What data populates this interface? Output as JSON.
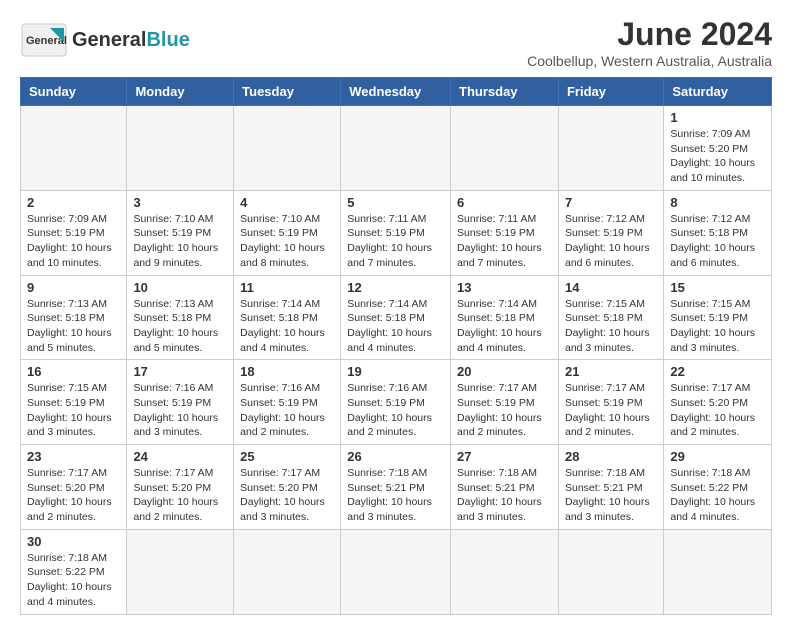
{
  "header": {
    "logo_general": "General",
    "logo_blue": "Blue",
    "month_title": "June 2024",
    "subtitle": "Coolbellup, Western Australia, Australia"
  },
  "weekdays": [
    "Sunday",
    "Monday",
    "Tuesday",
    "Wednesday",
    "Thursday",
    "Friday",
    "Saturday"
  ],
  "weeks": [
    [
      {
        "day": "",
        "info": ""
      },
      {
        "day": "",
        "info": ""
      },
      {
        "day": "",
        "info": ""
      },
      {
        "day": "",
        "info": ""
      },
      {
        "day": "",
        "info": ""
      },
      {
        "day": "",
        "info": ""
      },
      {
        "day": "1",
        "info": "Sunrise: 7:09 AM\nSunset: 5:20 PM\nDaylight: 10 hours\nand 10 minutes."
      }
    ],
    [
      {
        "day": "2",
        "info": "Sunrise: 7:09 AM\nSunset: 5:19 PM\nDaylight: 10 hours\nand 10 minutes."
      },
      {
        "day": "3",
        "info": "Sunrise: 7:10 AM\nSunset: 5:19 PM\nDaylight: 10 hours\nand 9 minutes."
      },
      {
        "day": "4",
        "info": "Sunrise: 7:10 AM\nSunset: 5:19 PM\nDaylight: 10 hours\nand 8 minutes."
      },
      {
        "day": "5",
        "info": "Sunrise: 7:11 AM\nSunset: 5:19 PM\nDaylight: 10 hours\nand 7 minutes."
      },
      {
        "day": "6",
        "info": "Sunrise: 7:11 AM\nSunset: 5:19 PM\nDaylight: 10 hours\nand 7 minutes."
      },
      {
        "day": "7",
        "info": "Sunrise: 7:12 AM\nSunset: 5:19 PM\nDaylight: 10 hours\nand 6 minutes."
      },
      {
        "day": "8",
        "info": "Sunrise: 7:12 AM\nSunset: 5:18 PM\nDaylight: 10 hours\nand 6 minutes."
      }
    ],
    [
      {
        "day": "9",
        "info": "Sunrise: 7:13 AM\nSunset: 5:18 PM\nDaylight: 10 hours\nand 5 minutes."
      },
      {
        "day": "10",
        "info": "Sunrise: 7:13 AM\nSunset: 5:18 PM\nDaylight: 10 hours\nand 5 minutes."
      },
      {
        "day": "11",
        "info": "Sunrise: 7:14 AM\nSunset: 5:18 PM\nDaylight: 10 hours\nand 4 minutes."
      },
      {
        "day": "12",
        "info": "Sunrise: 7:14 AM\nSunset: 5:18 PM\nDaylight: 10 hours\nand 4 minutes."
      },
      {
        "day": "13",
        "info": "Sunrise: 7:14 AM\nSunset: 5:18 PM\nDaylight: 10 hours\nand 4 minutes."
      },
      {
        "day": "14",
        "info": "Sunrise: 7:15 AM\nSunset: 5:18 PM\nDaylight: 10 hours\nand 3 minutes."
      },
      {
        "day": "15",
        "info": "Sunrise: 7:15 AM\nSunset: 5:19 PM\nDaylight: 10 hours\nand 3 minutes."
      }
    ],
    [
      {
        "day": "16",
        "info": "Sunrise: 7:15 AM\nSunset: 5:19 PM\nDaylight: 10 hours\nand 3 minutes."
      },
      {
        "day": "17",
        "info": "Sunrise: 7:16 AM\nSunset: 5:19 PM\nDaylight: 10 hours\nand 3 minutes."
      },
      {
        "day": "18",
        "info": "Sunrise: 7:16 AM\nSunset: 5:19 PM\nDaylight: 10 hours\nand 2 minutes."
      },
      {
        "day": "19",
        "info": "Sunrise: 7:16 AM\nSunset: 5:19 PM\nDaylight: 10 hours\nand 2 minutes."
      },
      {
        "day": "20",
        "info": "Sunrise: 7:17 AM\nSunset: 5:19 PM\nDaylight: 10 hours\nand 2 minutes."
      },
      {
        "day": "21",
        "info": "Sunrise: 7:17 AM\nSunset: 5:19 PM\nDaylight: 10 hours\nand 2 minutes."
      },
      {
        "day": "22",
        "info": "Sunrise: 7:17 AM\nSunset: 5:20 PM\nDaylight: 10 hours\nand 2 minutes."
      }
    ],
    [
      {
        "day": "23",
        "info": "Sunrise: 7:17 AM\nSunset: 5:20 PM\nDaylight: 10 hours\nand 2 minutes."
      },
      {
        "day": "24",
        "info": "Sunrise: 7:17 AM\nSunset: 5:20 PM\nDaylight: 10 hours\nand 2 minutes."
      },
      {
        "day": "25",
        "info": "Sunrise: 7:17 AM\nSunset: 5:20 PM\nDaylight: 10 hours\nand 3 minutes."
      },
      {
        "day": "26",
        "info": "Sunrise: 7:18 AM\nSunset: 5:21 PM\nDaylight: 10 hours\nand 3 minutes."
      },
      {
        "day": "27",
        "info": "Sunrise: 7:18 AM\nSunset: 5:21 PM\nDaylight: 10 hours\nand 3 minutes."
      },
      {
        "day": "28",
        "info": "Sunrise: 7:18 AM\nSunset: 5:21 PM\nDaylight: 10 hours\nand 3 minutes."
      },
      {
        "day": "29",
        "info": "Sunrise: 7:18 AM\nSunset: 5:22 PM\nDaylight: 10 hours\nand 4 minutes."
      }
    ],
    [
      {
        "day": "30",
        "info": "Sunrise: 7:18 AM\nSunset: 5:22 PM\nDaylight: 10 hours\nand 4 minutes."
      },
      {
        "day": "",
        "info": ""
      },
      {
        "day": "",
        "info": ""
      },
      {
        "day": "",
        "info": ""
      },
      {
        "day": "",
        "info": ""
      },
      {
        "day": "",
        "info": ""
      },
      {
        "day": "",
        "info": ""
      }
    ]
  ]
}
